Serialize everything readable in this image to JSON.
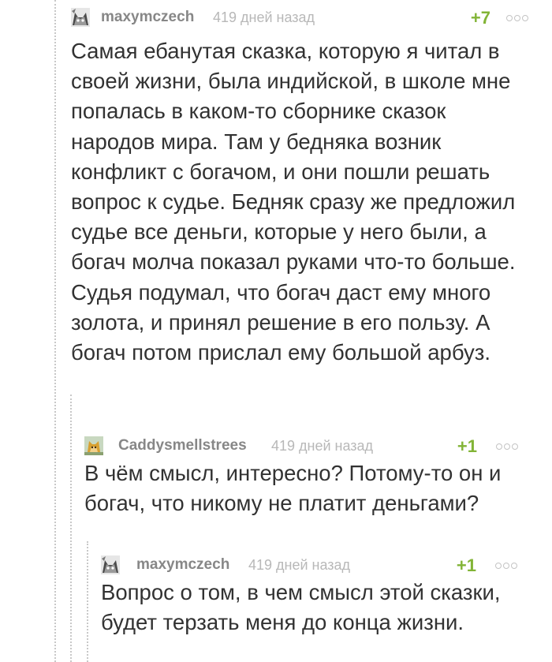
{
  "comments": [
    {
      "username": "maxymczech",
      "time": "419 дней назад",
      "rating": "+7",
      "avatar_icon": "cat-face-avatar",
      "text": "Самая ебанутая сказка, которую я читал в своей жизни, была индийской, в школе мне попалась в каком-то сборнике сказок народов мира. Там у бедняка возник конфликт с богачом, и они пошли решать вопрос к судье. Бедняк сразу же предложил судье все деньги, которые у него были, а богач молча показал руками что-то больше. Судья подумал, что богач даст ему много золота, и принял решение в его пользу. А богач потом прислал ему большой арбуз."
    },
    {
      "username": "Caddysmellstrees",
      "time": "419 дней назад",
      "rating": "+1",
      "avatar_icon": "fox-avatar",
      "text": "В чём смысл, интересно? Потому-то он и богач, что никому не платит деньгами?"
    },
    {
      "username": "maxymczech",
      "time": "419 дней назад",
      "rating": "+1",
      "avatar_icon": "cat-face-avatar",
      "text": "Вопрос о том, в чем смысл этой сказки, будет терзать меня до конца жизни."
    }
  ],
  "colors": {
    "rating_positive": "#82b436",
    "username": "#878787",
    "timestamp": "#b8b8b8",
    "body_text": "#323232",
    "thread_line": "#c8c8c8"
  }
}
